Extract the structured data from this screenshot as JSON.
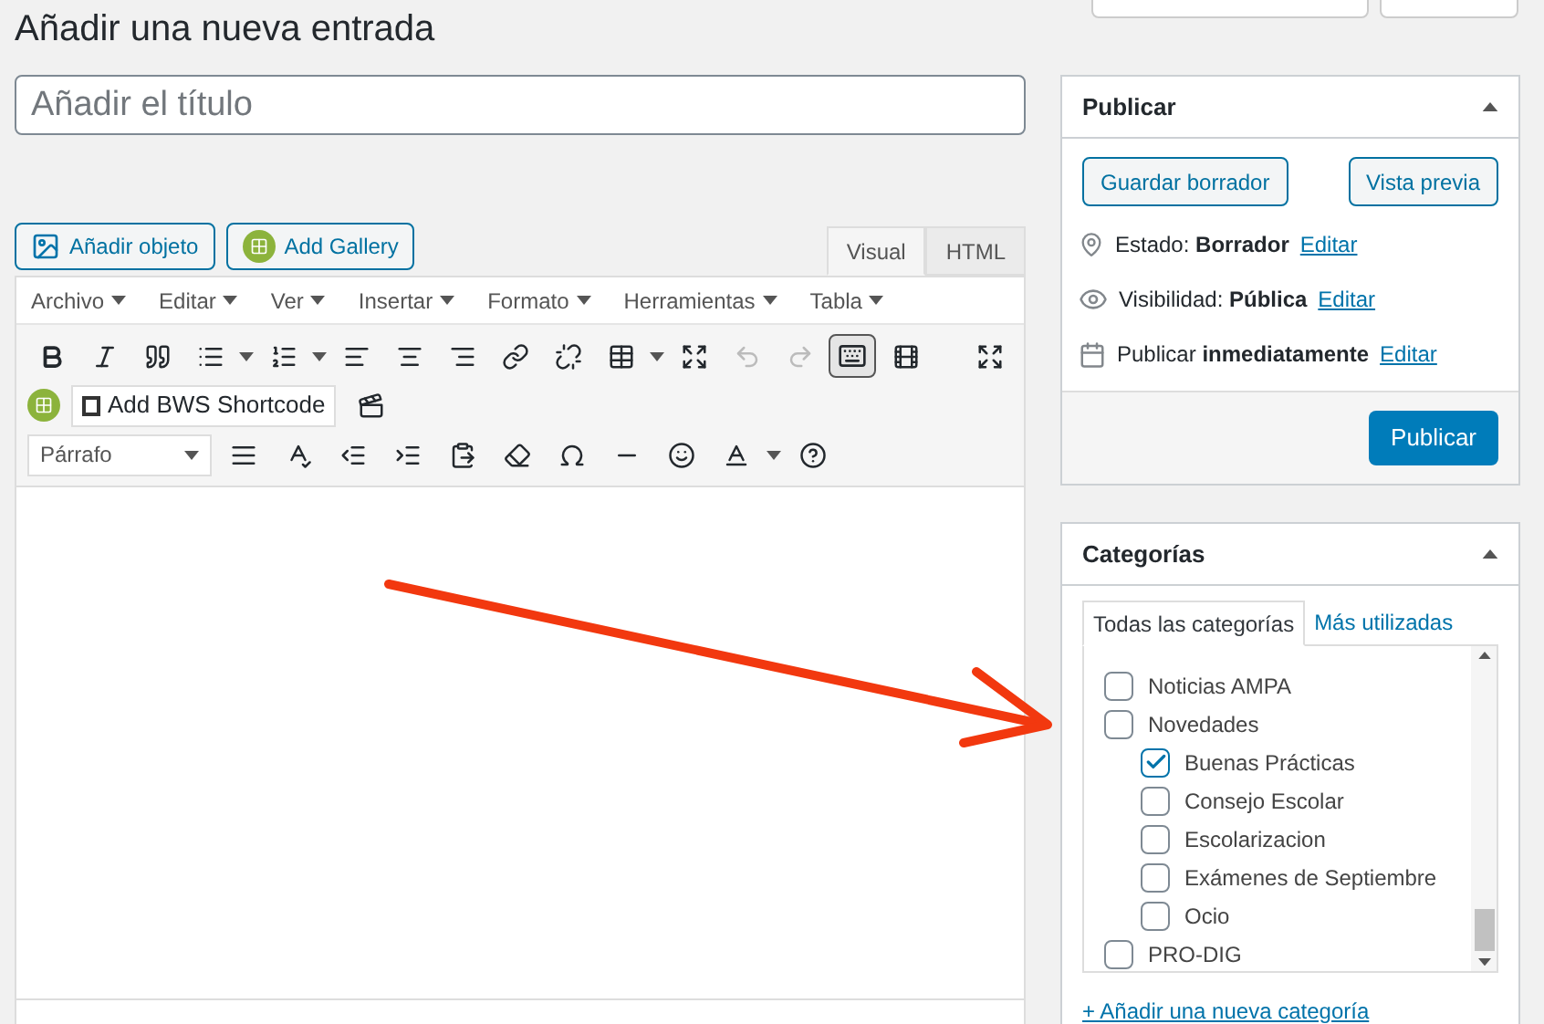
{
  "page": {
    "title": "Añadir una nueva entrada"
  },
  "title_field": {
    "placeholder": "Añadir el título"
  },
  "media_buttons": [
    {
      "kind": "media",
      "label": "Añadir objeto"
    },
    {
      "kind": "gallery",
      "label": "Add Gallery"
    }
  ],
  "editor_tabs": [
    {
      "label": "Visual",
      "selected": true
    },
    {
      "label": "HTML",
      "selected": false
    }
  ],
  "menubar": [
    "Archivo",
    "Editar",
    "Ver",
    "Insertar",
    "Formato",
    "Herramientas",
    "Tabla"
  ],
  "toolbar": {
    "toggle_pressed": true,
    "shortcode_label": "Add BWS Shortcode",
    "format_select": "Párrafo"
  },
  "publish": {
    "title": "Publicar",
    "save_button": "Guardar borrador",
    "preview_button": "Vista previa",
    "meta": [
      {
        "kind": "status",
        "text": "Estado: **Borrador**",
        "link": "Editar"
      },
      {
        "kind": "visibility",
        "text": "Visibilidad: **Pública**",
        "link": "Editar"
      },
      {
        "kind": "schedule",
        "text": "Publicar **inmediatamente**",
        "link": "Editar"
      }
    ],
    "publish_button": "Publicar"
  },
  "categories": {
    "title": "Categorías",
    "tabs": [
      {
        "label": "Todas las categorías",
        "selected": true
      },
      {
        "label": "Más utilizadas",
        "selected": false
      }
    ],
    "items": [
      {
        "label": "Noticias AMPA",
        "checked": false
      },
      {
        "label": "Novedades",
        "checked": false,
        "children": [
          {
            "label": "Buenas Prácticas",
            "checked": true
          },
          {
            "label": "Consejo Escolar",
            "checked": false
          },
          {
            "label": "Escolarizacion",
            "checked": false
          },
          {
            "label": "Exámenes de Septiembre",
            "checked": false
          },
          {
            "label": "Ocio",
            "checked": false
          }
        ]
      },
      {
        "label": "PRO-DIG",
        "checked": false
      }
    ],
    "add_link": "+ Añadir una nueva categoría"
  }
}
